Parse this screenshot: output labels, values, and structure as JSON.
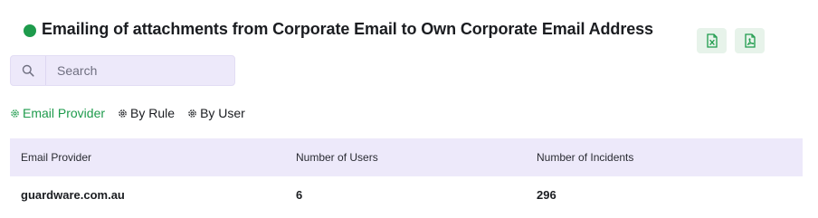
{
  "report": {
    "title": "Emailing of attachments from Corporate Email to Own Corporate Email Address",
    "status_color": "#1e9b4c"
  },
  "exports": {
    "excel_icon": "excel-file-icon",
    "pdf_icon": "pdf-file-icon"
  },
  "search": {
    "placeholder": "Search",
    "value": ""
  },
  "tabs": [
    {
      "label": "Email Provider",
      "active": true
    },
    {
      "label": "By Rule",
      "active": false
    },
    {
      "label": "By User",
      "active": false
    }
  ],
  "table": {
    "columns": [
      "Email Provider",
      "Number of Users",
      "Number of Incidents"
    ],
    "rows": [
      [
        "guardware.com.au",
        "6",
        "296"
      ]
    ]
  },
  "colors": {
    "accent": "#1e9b4c",
    "header_bg": "#ede9fa"
  }
}
